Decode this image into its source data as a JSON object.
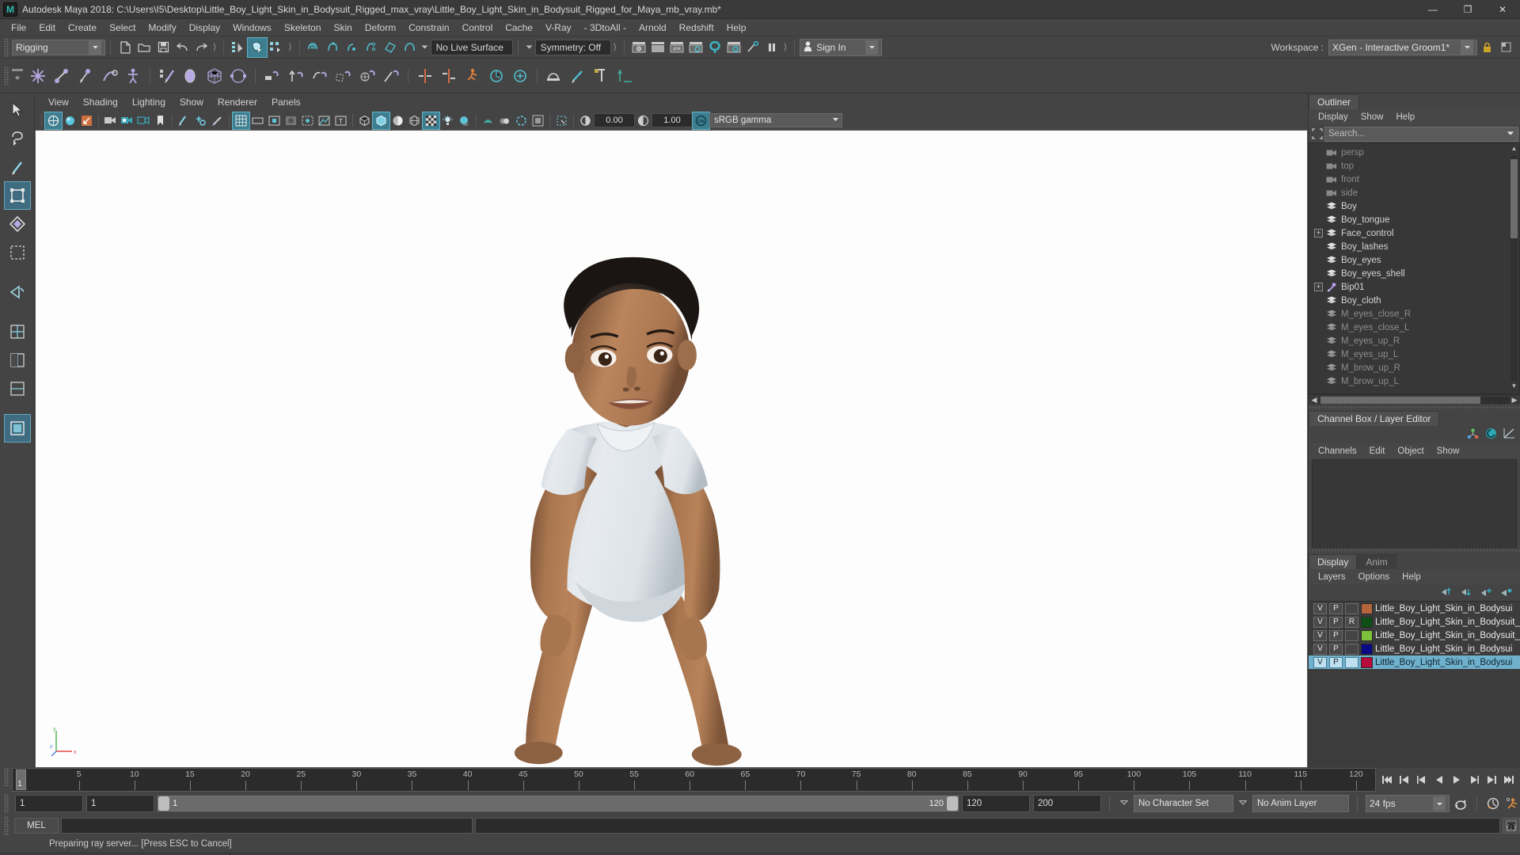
{
  "window": {
    "title": "Autodesk Maya 2018: C:\\Users\\I5\\Desktop\\Little_Boy_Light_Skin_in_Bodysuit_Rigged_max_vray\\Little_Boy_Light_Skin_in_Bodysuit_Rigged_for_Maya_mb_vray.mb*",
    "logo_letter": "M",
    "minimize": "—",
    "maximize": "❐",
    "close": "✕"
  },
  "menubar": {
    "items": [
      "File",
      "Edit",
      "Create",
      "Select",
      "Modify",
      "Display",
      "Windows",
      "Skeleton",
      "Skin",
      "Deform",
      "Constrain",
      "Control",
      "Cache",
      "V-Ray",
      "- 3DtoAll -",
      "Arnold",
      "Redshift",
      "Help"
    ]
  },
  "statusline": {
    "menuset": "Rigging",
    "live_surface": "No Live Surface",
    "symmetry": "Symmetry: Off",
    "sign_in": "Sign In",
    "workspace_label": "Workspace :",
    "workspace_value": "XGen - Interactive Groom1*"
  },
  "viewport_menu": {
    "items": [
      "View",
      "Shading",
      "Lighting",
      "Show",
      "Renderer",
      "Panels"
    ]
  },
  "viewport_bar": {
    "exposure": "0.00",
    "gamma": "1.00",
    "color_profile": "sRGB gamma",
    "color_mgmt_toggle": "ON"
  },
  "outliner": {
    "tab": "Outliner",
    "menus": [
      "Display",
      "Show",
      "Help"
    ],
    "search_placeholder": "Search...",
    "items": [
      {
        "label": "persp",
        "icon": "camera-icon",
        "dim": true,
        "expander": false
      },
      {
        "label": "top",
        "icon": "camera-icon",
        "dim": true,
        "expander": false
      },
      {
        "label": "front",
        "icon": "camera-icon",
        "dim": true,
        "expander": false
      },
      {
        "label": "side",
        "icon": "camera-icon",
        "dim": true,
        "expander": false
      },
      {
        "label": "Boy",
        "icon": "mesh-icon",
        "dim": false,
        "expander": false
      },
      {
        "label": "Boy_tongue",
        "icon": "mesh-icon",
        "dim": false,
        "expander": false
      },
      {
        "label": "Face_control",
        "icon": "mesh-icon",
        "dim": false,
        "expander": true
      },
      {
        "label": "Boy_lashes",
        "icon": "mesh-icon",
        "dim": false,
        "expander": false
      },
      {
        "label": "Boy_eyes",
        "icon": "mesh-icon",
        "dim": false,
        "expander": false
      },
      {
        "label": "Boy_eyes_shell",
        "icon": "mesh-icon",
        "dim": false,
        "expander": false
      },
      {
        "label": "Bip01",
        "icon": "joint-icon",
        "dim": false,
        "expander": true
      },
      {
        "label": "Boy_cloth",
        "icon": "mesh-icon",
        "dim": false,
        "expander": false
      },
      {
        "label": "M_eyes_close_R",
        "icon": "mesh-icon",
        "dim": true,
        "expander": false
      },
      {
        "label": "M_eyes_close_L",
        "icon": "mesh-icon",
        "dim": true,
        "expander": false
      },
      {
        "label": "M_eyes_up_R",
        "icon": "mesh-icon",
        "dim": true,
        "expander": false
      },
      {
        "label": "M_eyes_up_L",
        "icon": "mesh-icon",
        "dim": true,
        "expander": false
      },
      {
        "label": "M_brow_up_R",
        "icon": "mesh-icon",
        "dim": true,
        "expander": false
      },
      {
        "label": "M_brow_up_L",
        "icon": "mesh-icon",
        "dim": true,
        "expander": false
      }
    ]
  },
  "channelbox": {
    "tab": "Channel Box / Layer Editor",
    "menus": [
      "Channels",
      "Edit",
      "Object",
      "Show"
    ]
  },
  "layer_editor": {
    "tabs": [
      {
        "label": "Display",
        "active": true
      },
      {
        "label": "Anim",
        "active": false
      }
    ],
    "menus": [
      "Layers",
      "Options",
      "Help"
    ],
    "layers": [
      {
        "v": "V",
        "p": "P",
        "r": "",
        "color": "#b5653c",
        "name": "Little_Boy_Light_Skin_in_Bodysui",
        "selected": false
      },
      {
        "v": "V",
        "p": "P",
        "r": "R",
        "color": "#0d4f17",
        "name": "Little_Boy_Light_Skin_in_Bodysuit_Rigg",
        "selected": false
      },
      {
        "v": "V",
        "p": "P",
        "r": "",
        "color": "#7ec13a",
        "name": "Little_Boy_Light_Skin_in_Bodysuit_Ri",
        "selected": false
      },
      {
        "v": "V",
        "p": "P",
        "r": "",
        "color": "#0a0a86",
        "name": "Little_Boy_Light_Skin_in_Bodysui",
        "selected": false
      },
      {
        "v": "V",
        "p": "P",
        "r": "",
        "color": "#b80b3c",
        "name": "Little_Boy_Light_Skin_in_Bodysui",
        "selected": true
      }
    ]
  },
  "timeline": {
    "current_frame": "1",
    "ticks": [
      5,
      10,
      15,
      20,
      25,
      30,
      35,
      40,
      45,
      50,
      55,
      60,
      65,
      70,
      75,
      80,
      85,
      90,
      95,
      100,
      105,
      110,
      115,
      120
    ],
    "range_min": 1,
    "range_max": 120
  },
  "playback": {
    "start_field": "1",
    "current_field": "1",
    "range_start_label": "1",
    "range_end_label": "120",
    "range_end_field": "120",
    "playback_end_field": "200",
    "character_set": "No Character Set",
    "anim_layer": "No Anim Layer",
    "fps": "24 fps"
  },
  "command_line": {
    "language": "MEL",
    "input": "",
    "output": ""
  },
  "help_line": {
    "text": "Preparing ray server... [Press ESC to Cancel]"
  },
  "colors": {
    "accent_teal": "#2fb1c4",
    "panel_bg": "#444444",
    "dark_bg": "#373737",
    "selection_blue": "#6fb1cd"
  }
}
